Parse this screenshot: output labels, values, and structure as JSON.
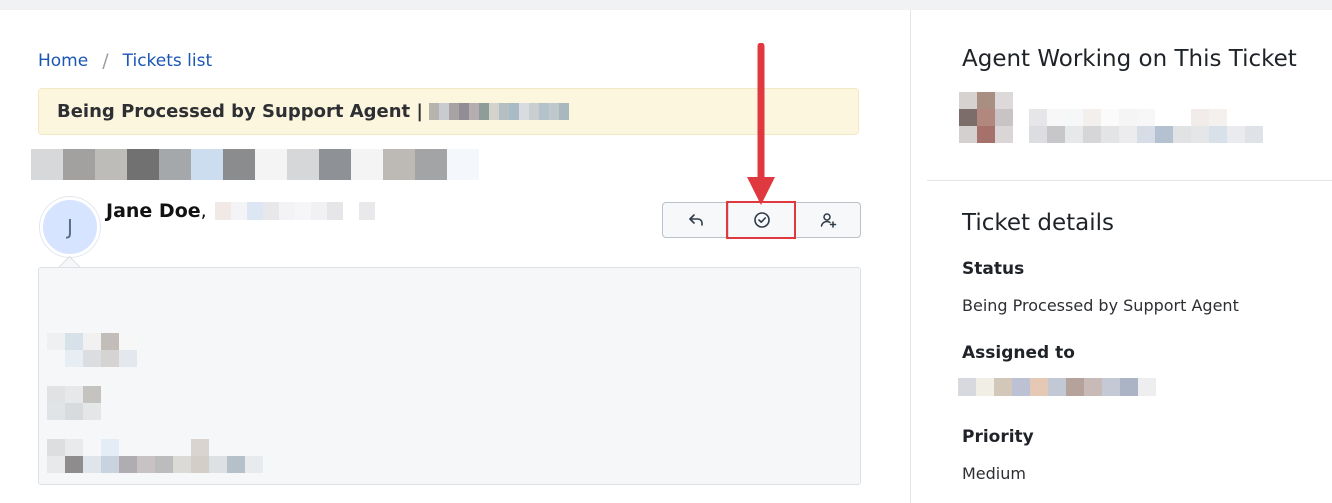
{
  "breadcrumb": {
    "home": "Home",
    "separator": "/",
    "tickets_list": "Tickets list"
  },
  "banner": {
    "text": "Being Processed by Support Agent |"
  },
  "message": {
    "avatar_initial": "J",
    "author_name": "Jane Doe",
    "author_separator": ","
  },
  "actions": {
    "reply_icon": "reply-icon",
    "resolve_icon": "check-circle-icon",
    "assign_icon": "user-plus-icon"
  },
  "sidebar": {
    "agent_heading": "Agent Working on This Ticket",
    "details_heading": "Ticket details",
    "status_label": "Status",
    "status_value": "Being Processed by Support Agent",
    "assigned_label": "Assigned to",
    "priority_label": "Priority",
    "priority_value": "Medium"
  },
  "colors": {
    "link": "#1a56b4",
    "banner_bg": "#fdf6df",
    "highlight": "#e0383f",
    "avatar_bg": "#d6e4ff"
  }
}
